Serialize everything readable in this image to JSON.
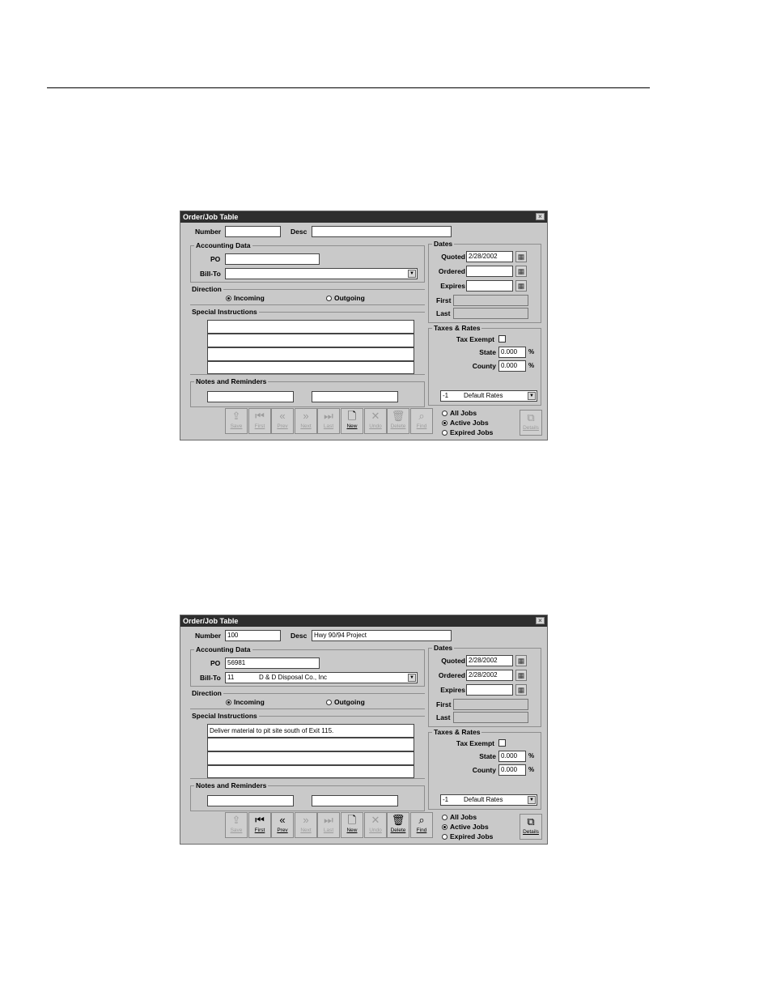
{
  "screens": [
    {
      "title": "Order/Job Table",
      "close_glyph": "×",
      "number_label": "Number",
      "number_value": "",
      "desc_label": "Desc",
      "desc_value": "",
      "accounting_title": "Accounting Data",
      "po_label": "PO",
      "po_value": "",
      "billto_label": "Bill-To",
      "billto_id": "",
      "billto_name": "",
      "direction_title": "Direction",
      "direction_incoming": "Incoming",
      "direction_outgoing": "Outgoing",
      "direction_selected": "Incoming",
      "special_title": "Special Instructions",
      "special_lines": [
        "",
        "",
        "",
        ""
      ],
      "notes_title": "Notes and Reminders",
      "notes_values": [
        "",
        ""
      ],
      "dates_title": "Dates",
      "quoted_label": "Quoted",
      "quoted_value": "2/28/2002",
      "ordered_label": "Ordered",
      "ordered_value": "",
      "expires_label": "Expires",
      "expires_value": "",
      "first_label": "First",
      "first_value": "",
      "last_label": "Last",
      "last_value": "",
      "taxes_title": "Taxes & Rates",
      "tax_exempt_label": "Tax Exempt",
      "tax_exempt_checked": false,
      "state_label": "State",
      "state_value": "0.000",
      "county_label": "County",
      "county_value": "0.000",
      "percent_sign": "%",
      "rates_id": "-1",
      "rates_name": "Default Rates",
      "filter_all": "All Jobs",
      "filter_active": "Active Jobs",
      "filter_expired": "Expired Jobs",
      "filter_selected": "Active Jobs",
      "toolbar": [
        {
          "label": "Save",
          "icon": "save-icon",
          "glyph": "⇪",
          "enabled": false
        },
        {
          "label": "First",
          "icon": "first-record-icon",
          "glyph": "⏮",
          "enabled": false
        },
        {
          "label": "Prev",
          "icon": "previous-record-icon",
          "glyph": "«",
          "enabled": false
        },
        {
          "label": "Next",
          "icon": "next-record-icon",
          "glyph": "»",
          "enabled": false
        },
        {
          "label": "Last",
          "icon": "last-record-icon",
          "glyph": "⏭",
          "enabled": false
        },
        {
          "label": "New",
          "icon": "new-record-icon",
          "glyph": "🗋",
          "enabled": true
        },
        {
          "label": "Undo",
          "icon": "undo-icon",
          "glyph": "✕",
          "enabled": false
        },
        {
          "label": "Delete",
          "icon": "delete-icon",
          "glyph": "🗑",
          "enabled": false
        },
        {
          "label": "Find",
          "icon": "find-icon",
          "glyph": "⌕",
          "enabled": false
        }
      ],
      "detail_label": "Details",
      "detail_enabled": false
    },
    {
      "title": "Order/Job Table",
      "close_glyph": "×",
      "number_label": "Number",
      "number_value": "100",
      "desc_label": "Desc",
      "desc_value": "Hwy 90/94 Project",
      "accounting_title": "Accounting Data",
      "po_label": "PO",
      "po_value": "56981",
      "billto_label": "Bill-To",
      "billto_id": "11",
      "billto_name": "D & D Disposal Co., Inc",
      "direction_title": "Direction",
      "direction_incoming": "Incoming",
      "direction_outgoing": "Outgoing",
      "direction_selected": "Incoming",
      "special_title": "Special Instructions",
      "special_lines": [
        "Deliver material to pit site south of Exit 115.",
        "",
        "",
        ""
      ],
      "notes_title": "Notes and Reminders",
      "notes_values": [
        "",
        ""
      ],
      "dates_title": "Dates",
      "quoted_label": "Quoted",
      "quoted_value": "2/28/2002",
      "ordered_label": "Ordered",
      "ordered_value": "2/28/2002",
      "expires_label": "Expires",
      "expires_value": "",
      "first_label": "First",
      "first_value": "",
      "last_label": "Last",
      "last_value": "",
      "taxes_title": "Taxes & Rates",
      "tax_exempt_label": "Tax Exempt",
      "tax_exempt_checked": false,
      "state_label": "State",
      "state_value": "0.000",
      "county_label": "County",
      "county_value": "0.000",
      "percent_sign": "%",
      "rates_id": "-1",
      "rates_name": "Default Rates",
      "filter_all": "All Jobs",
      "filter_active": "Active Jobs",
      "filter_expired": "Expired Jobs",
      "filter_selected": "Active Jobs",
      "toolbar": [
        {
          "label": "Save",
          "icon": "save-icon",
          "glyph": "⇪",
          "enabled": false
        },
        {
          "label": "First",
          "icon": "first-record-icon",
          "glyph": "⏮",
          "enabled": true
        },
        {
          "label": "Prev",
          "icon": "previous-record-icon",
          "glyph": "«",
          "enabled": true
        },
        {
          "label": "Next",
          "icon": "next-record-icon",
          "glyph": "»",
          "enabled": false
        },
        {
          "label": "Last",
          "icon": "last-record-icon",
          "glyph": "⏭",
          "enabled": false
        },
        {
          "label": "New",
          "icon": "new-record-icon",
          "glyph": "🗋",
          "enabled": true
        },
        {
          "label": "Undo",
          "icon": "undo-icon",
          "glyph": "✕",
          "enabled": false
        },
        {
          "label": "Delete",
          "icon": "delete-icon",
          "glyph": "🗑",
          "enabled": true
        },
        {
          "label": "Find",
          "icon": "find-icon",
          "glyph": "⌕",
          "enabled": true
        }
      ],
      "detail_label": "Details",
      "detail_enabled": true
    }
  ]
}
